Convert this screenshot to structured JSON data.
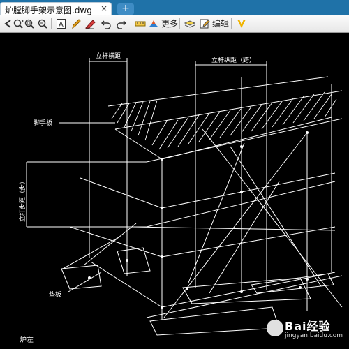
{
  "tab": {
    "title": "炉膛脚手架示意图.dwg",
    "close": "×",
    "add": "+"
  },
  "toolbar": {
    "icons": [
      "back-arrow-icon",
      "zoom-pan-icon",
      "zoom-window-icon",
      "zoom-extents-icon",
      "text-tool-icon",
      "pencil-icon",
      "eraser-icon",
      "undo-icon",
      "redo-icon",
      "measure-icon",
      "layer-icon",
      "more-icon",
      "layers-stack-icon",
      "edit-icon",
      "vip-icon"
    ],
    "more_label": "更多",
    "edit_label": "编辑"
  },
  "drawing": {
    "labels": {
      "pole_transverse": "立杆横距",
      "pole_longitudinal": "立杆纵距（跨）",
      "scaffold_board": "脚手板",
      "pole_step": "立杆步距（步）",
      "base_plate": "垫板",
      "left_side": "炉左"
    },
    "colors": {
      "background": "#000000",
      "lines": "#ffffff"
    }
  },
  "watermark": {
    "text": "Bai经验",
    "url": "jingyan.baidu.com"
  }
}
